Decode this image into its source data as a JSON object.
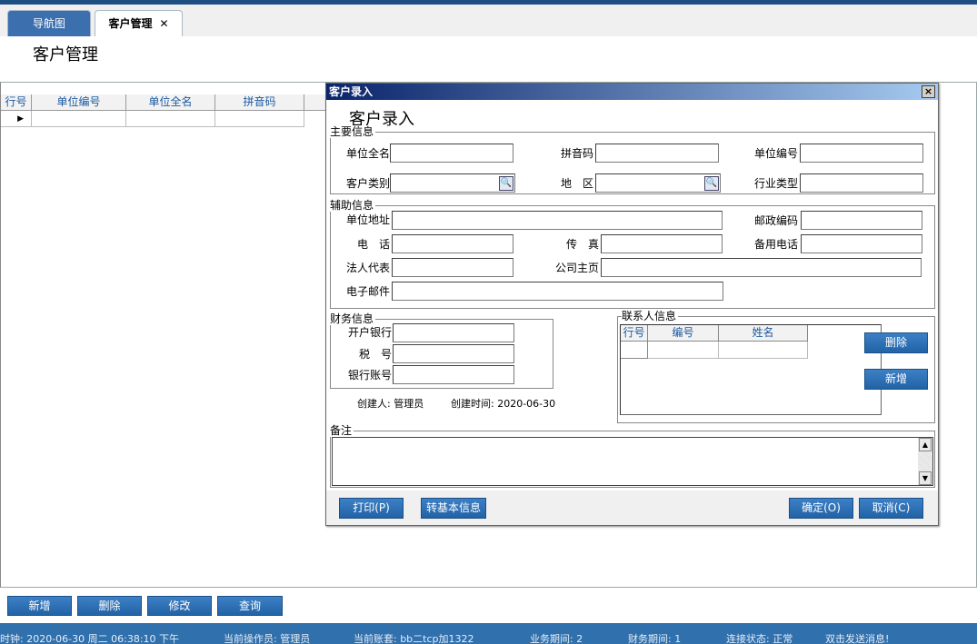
{
  "tabs": [
    {
      "label": "导航图"
    },
    {
      "label": "客户管理",
      "close": "✕"
    }
  ],
  "page_title": "客户管理",
  "grid": {
    "columns": [
      "行号",
      "单位编号",
      "单位全名",
      "拼音码"
    ],
    "row_marker": "▶"
  },
  "bottom_buttons": [
    "新增",
    "删除",
    "修改",
    "查询"
  ],
  "status": [
    "时钟: 2020-06-30 周二 06:38:10 下午",
    "当前操作员: 管理员",
    "当前账套: bb二tcp加1322",
    "业务期间: 2",
    "财务期间: 1",
    "连接状态: 正常",
    "双击发送消息!"
  ],
  "dialog": {
    "title": "客户录入",
    "close": "×",
    "heading": "客户录入",
    "main_info": {
      "legend": "主要信息",
      "unit_name": "单位全名",
      "pinyin": "拼音码",
      "unit_code": "单位编号",
      "cust_type": "客户类别",
      "region": "地　区",
      "industry": "行业类型"
    },
    "aux_info": {
      "legend": "辅助信息",
      "address": "单位地址",
      "postcode": "邮政编码",
      "phone": "电　话",
      "fax": "传　真",
      "alt_phone": "备用电话",
      "legal": "法人代表",
      "homepage": "公司主页",
      "email": "电子邮件"
    },
    "finance": {
      "legend": "财务信息",
      "bank": "开户银行",
      "tax": "税　号",
      "account": "银行账号"
    },
    "creator": "创建人: 管理员",
    "created": "创建时间: 2020-06-30",
    "contacts": {
      "legend": "联系人信息",
      "columns": [
        "行号",
        "编号",
        "姓名"
      ],
      "delete": "删除",
      "add": "新增"
    },
    "remarks": {
      "legend": "备注"
    },
    "buttons": {
      "print": "打印(P)",
      "to_basic": "转基本信息",
      "ok": "确定(O)",
      "cancel": "取消(C)"
    }
  }
}
